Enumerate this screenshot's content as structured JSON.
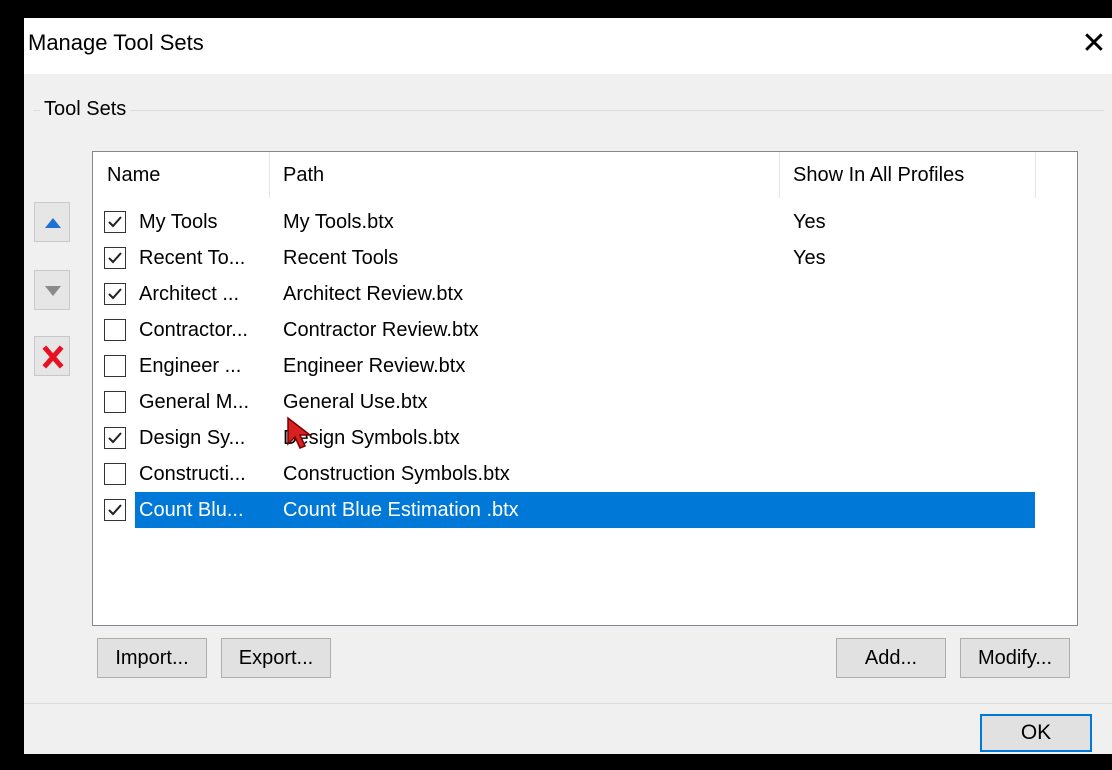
{
  "window": {
    "title": "Manage Tool Sets",
    "close_glyph": "✕"
  },
  "group": {
    "label": "Tool Sets"
  },
  "side_buttons": [
    {
      "name": "move-up",
      "icon": "arrow-up-icon",
      "color": "#1e73d2"
    },
    {
      "name": "move-down",
      "icon": "arrow-down-icon",
      "color": "#8a8a8a"
    },
    {
      "name": "delete",
      "icon": "red-x-icon",
      "color": "#e81123"
    }
  ],
  "list": {
    "columns": [
      "Name",
      "Path",
      "Show In All Profiles"
    ],
    "rows": [
      {
        "checked": true,
        "name": "My Tools",
        "path": "My Tools.btx",
        "show": "Yes",
        "selected": false
      },
      {
        "checked": true,
        "name": "Recent To...",
        "path": "Recent Tools",
        "show": "Yes",
        "selected": false
      },
      {
        "checked": true,
        "name": "Architect ...",
        "path": "Architect Review.btx",
        "show": "",
        "selected": false
      },
      {
        "checked": false,
        "name": "Contractor...",
        "path": "Contractor Review.btx",
        "show": "",
        "selected": false
      },
      {
        "checked": false,
        "name": "Engineer ...",
        "path": "Engineer Review.btx",
        "show": "",
        "selected": false
      },
      {
        "checked": false,
        "name": "General M...",
        "path": "General Use.btx",
        "show": "",
        "selected": false
      },
      {
        "checked": true,
        "name": "Design Sy...",
        "path": "Design Symbols.btx",
        "show": "",
        "selected": false
      },
      {
        "checked": false,
        "name": "Constructi...",
        "path": "Construction Symbols.btx",
        "show": "",
        "selected": false
      },
      {
        "checked": true,
        "name": "Count Blu...",
        "path": "Count Blue Estimation  .btx",
        "show": "",
        "selected": true
      }
    ]
  },
  "buttons": {
    "import": "Import...",
    "export": "Export...",
    "add": "Add...",
    "modify": "Modify...",
    "ok": "OK"
  },
  "colors": {
    "selection": "#0078d7",
    "cursor": "#d92020"
  }
}
